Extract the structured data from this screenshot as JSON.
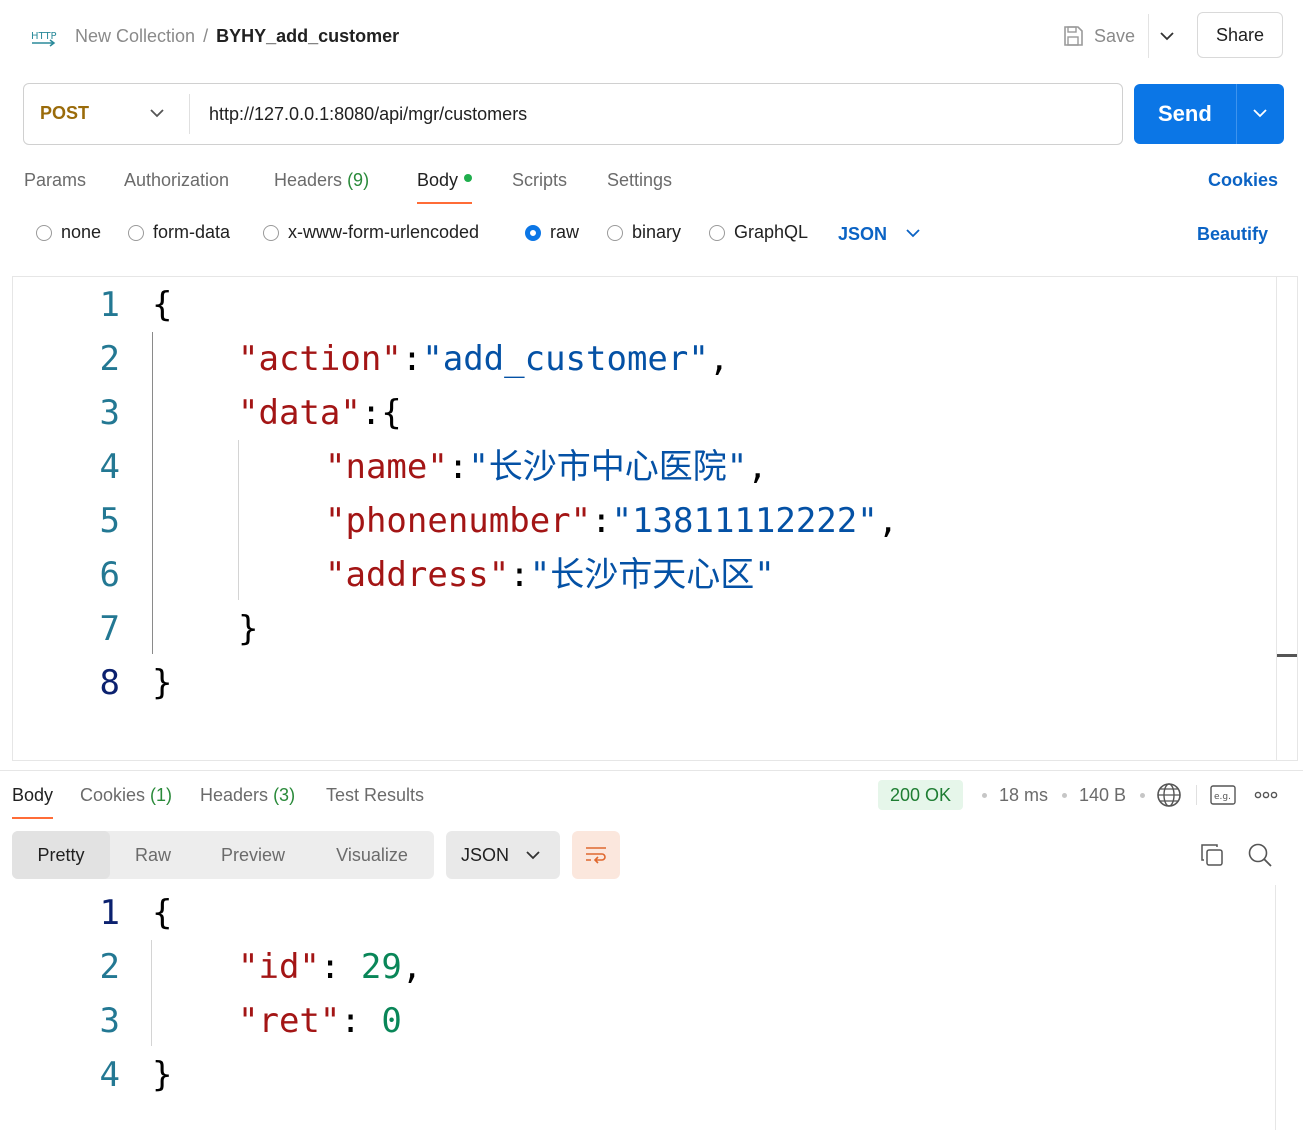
{
  "header": {
    "http_icon": "http-request-icon",
    "collection": "New Collection",
    "separator": "/",
    "request_name": "BYHY_add_customer",
    "save_label": "Save",
    "share_label": "Share"
  },
  "request": {
    "method": "POST",
    "url": "http://127.0.0.1:8080/api/mgr/customers",
    "send_label": "Send",
    "accent": "#0b76e6"
  },
  "request_tabs": [
    {
      "label": "Params"
    },
    {
      "label": "Authorization"
    },
    {
      "label": "Headers",
      "count": "(9)"
    },
    {
      "label": "Body",
      "active": true
    },
    {
      "label": "Scripts"
    },
    {
      "label": "Settings"
    }
  ],
  "cookies_label": "Cookies",
  "body_types": [
    "none",
    "form-data",
    "x-www-form-urlencoded",
    "raw",
    "binary",
    "GraphQL"
  ],
  "body_type_selected": "raw",
  "body_format": "JSON",
  "beautify_label": "Beautify",
  "request_body": {
    "line_numbers": [
      "1",
      "2",
      "3",
      "4",
      "5",
      "6",
      "7",
      "8"
    ],
    "lines": [
      [
        {
          "t": "{",
          "c": "p"
        }
      ],
      [
        {
          "t": "\"action\"",
          "c": "k"
        },
        {
          "t": ":",
          "c": "p"
        },
        {
          "t": "\"add_customer\"",
          "c": "s"
        },
        {
          "t": ",",
          "c": "p"
        }
      ],
      [
        {
          "t": "\"data\"",
          "c": "k"
        },
        {
          "t": ":{",
          "c": "p"
        }
      ],
      [
        {
          "t": "\"name\"",
          "c": "k"
        },
        {
          "t": ":",
          "c": "p"
        },
        {
          "t": "\"长沙市中心医院\"",
          "c": "s"
        },
        {
          "t": ",",
          "c": "p"
        }
      ],
      [
        {
          "t": "\"phonenumber\"",
          "c": "k"
        },
        {
          "t": ":",
          "c": "p"
        },
        {
          "t": "\"13811112222\"",
          "c": "s"
        },
        {
          "t": ",",
          "c": "p"
        }
      ],
      [
        {
          "t": "\"address\"",
          "c": "k"
        },
        {
          "t": ":",
          "c": "p"
        },
        {
          "t": "\"长沙市天心区\"",
          "c": "s"
        }
      ],
      [
        {
          "t": "}",
          "c": "p"
        }
      ],
      [
        {
          "t": "}",
          "c": "p"
        }
      ]
    ]
  },
  "response_tabs": [
    {
      "label": "Body",
      "active": true
    },
    {
      "label": "Cookies",
      "count": "(1)"
    },
    {
      "label": "Headers",
      "count": "(3)"
    },
    {
      "label": "Test Results"
    }
  ],
  "response_meta": {
    "status": "200 OK",
    "time": "18 ms",
    "size": "140 B"
  },
  "response_views": [
    "Pretty",
    "Raw",
    "Preview",
    "Visualize"
  ],
  "response_format": "JSON",
  "response_body": {
    "line_numbers": [
      "1",
      "2",
      "3",
      "4"
    ],
    "lines": [
      [
        {
          "t": "{",
          "c": "p"
        }
      ],
      [
        {
          "t": "\"id\"",
          "c": "k"
        },
        {
          "t": ": ",
          "c": "p"
        },
        {
          "t": "29",
          "c": "n"
        },
        {
          "t": ",",
          "c": "p"
        }
      ],
      [
        {
          "t": "\"ret\"",
          "c": "k"
        },
        {
          "t": ": ",
          "c": "p"
        },
        {
          "t": "0",
          "c": "n"
        }
      ],
      [
        {
          "t": "}",
          "c": "p"
        }
      ]
    ]
  }
}
